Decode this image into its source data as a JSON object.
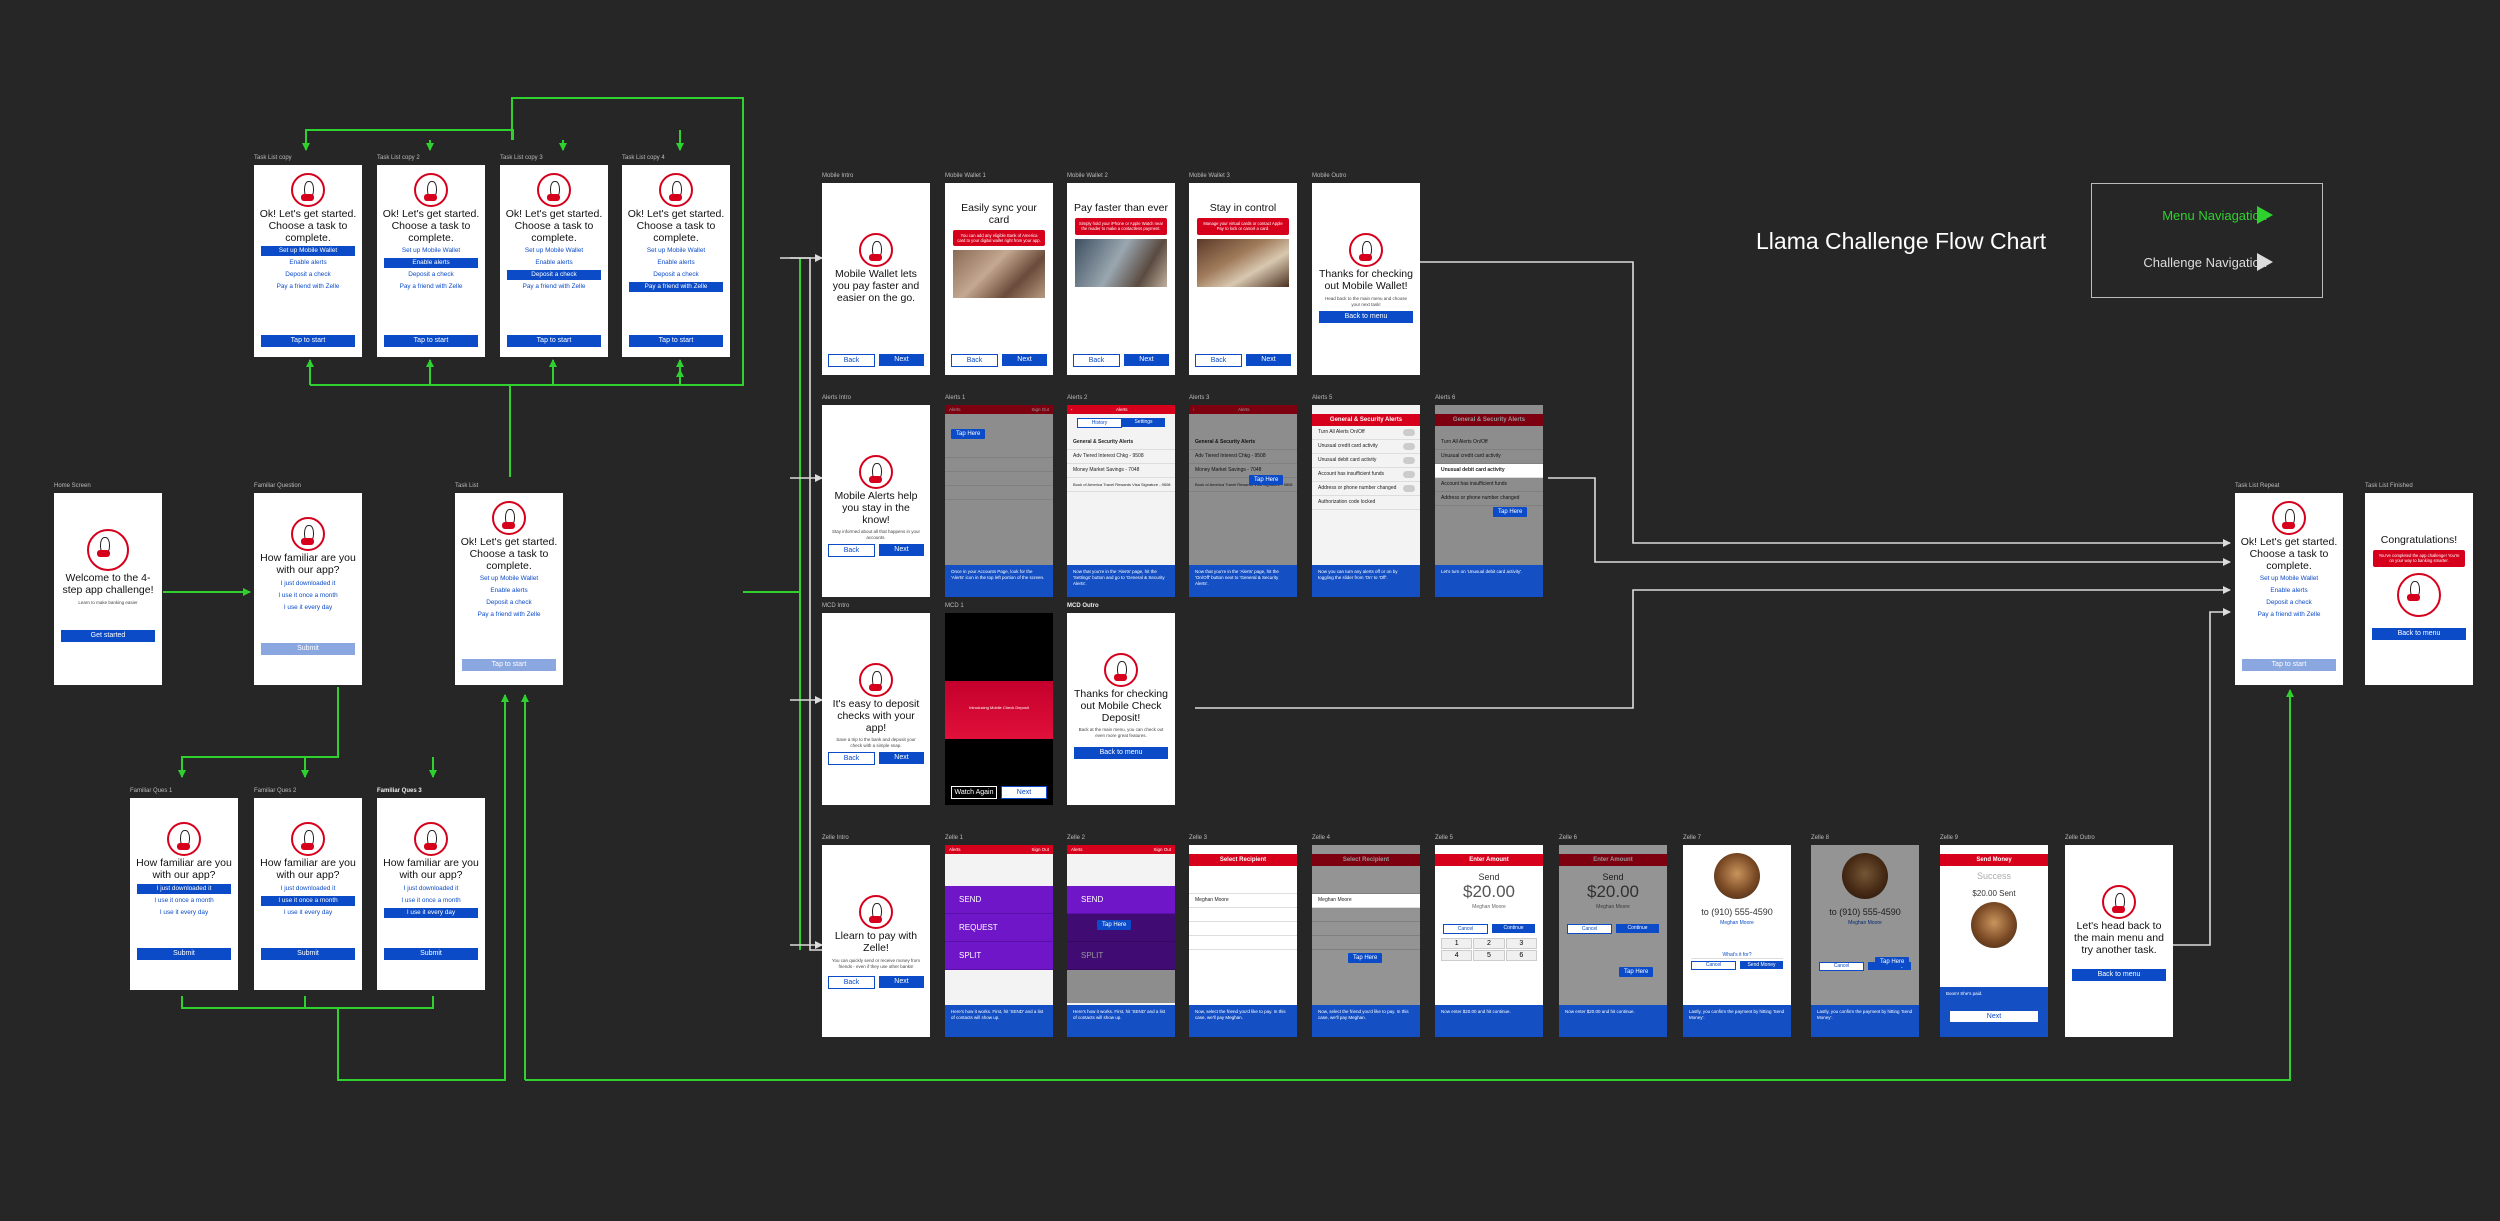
{
  "title": "Llama Challenge Flow Chart",
  "legend": {
    "menu": "Menu Naviagation",
    "challenge": "Challenge Navigation",
    "menu_color": "#2ed12e",
    "challenge_color": "#dcdcdc"
  },
  "labels": {
    "home": "Home Screen",
    "familiar_q": "Familiar Question",
    "task_list": "Task List",
    "tl_copy": "Task List copy",
    "tl_copy2": "Task List copy 2",
    "tl_copy3": "Task List copy 3",
    "tl_copy4": "Task List copy 4",
    "fq1": "Familiar Ques 1",
    "fq2": "Familiar Ques 2",
    "fq3": "Familiar Ques 3",
    "mw_intro": "Mobile Intro",
    "mw1": "Mobile Wallet 1",
    "mw2": "Mobile Wallet 2",
    "mw3": "Mobile Wallet 3",
    "mw_outro": "Mobile Outro",
    "al_intro": "Alerts Intro",
    "al1": "Alerts 1",
    "al2": "Alerts 2",
    "al3": "Alerts 3",
    "al5": "Alerts 5",
    "al6": "Alerts 6",
    "mcd_intro": "MCD Intro",
    "mcd1": "MCD 1",
    "mcd_outro": "MCD Outro",
    "z_intro": "Zelle Intro",
    "z1": "Zelle 1",
    "z2": "Zelle 2",
    "z3": "Zelle 3",
    "z4": "Zelle 4",
    "z5": "Zelle 5",
    "z6": "Zelle 6",
    "z7": "Zelle 7",
    "z8": "Zelle 8",
    "z9": "Zelle 9",
    "z_outro": "Zelle Outro",
    "tl_repeat": "Task List Repeat",
    "tl_finished": "Task List Finished"
  },
  "common": {
    "start_title": "Ok! Let's get started. Choose a task to complete.",
    "familiar_title": "How familiar are you with our app?",
    "tasks": [
      "Set up Mobile Wallet",
      "Enable alerts",
      "Deposit a check",
      "Pay a friend with Zelle"
    ],
    "familiar_opts": [
      "I just downloaded it",
      "I use it once a month",
      "I use it every day"
    ],
    "tap_to_start": "Tap to start",
    "submit": "Submit",
    "back": "Back",
    "next": "Next",
    "back_to_menu": "Back to menu",
    "tap_here": "Tap Here"
  },
  "home": {
    "title": "Welcome to the 4-step app challenge!",
    "sub": "Learn to make banking easier",
    "btn": "Get started"
  },
  "mw": {
    "intro": "Mobile Wallet lets you pay faster and easier on the go.",
    "s1": "Easily sync your card",
    "s2": "Pay faster than ever",
    "s3": "Stay in control",
    "b1": "You can add any eligible Bank of America card to your digital wallet right from your app.",
    "b2": "Simply hold your iPhone or Apple Watch near the reader to make a contactless payment.",
    "b3": "Manage your virtual cards or contact Apple Pay to lock or cancel a card.",
    "outro": "Thanks for checking out Mobile Wallet!",
    "outro_sub": "Head back to the main menu and choose your next task!"
  },
  "al": {
    "intro": "Mobile Alerts help you stay in the know!",
    "intro_sub": "Stay informed about all that happens in your accounts.",
    "app_title": "Alerts",
    "sign_out": "Sign Out",
    "tab1": "History",
    "tab2": "Settings",
    "gs": "General & Security Alerts",
    "rows": [
      "Adv Tiered Interest Chkg - 9508",
      "Money Market Savings - 7048",
      "Book of America Travel Rewards Visa Signature - 9508"
    ],
    "gs_rows": [
      "Turn All Alerts On/Off",
      "Unusual credit card activity",
      "Unusual debit card activity",
      "Account has insufficient funds",
      "Address or phone number changed",
      "Authorization code locked"
    ],
    "tip1": "Once in your Accounts Page, look for the 'Alerts' icon in the top left portion of the screen.",
    "tip2": "Now that you're in the 'Alerts' page, hit the 'Settings' button and go to 'General & Security Alerts'.",
    "tip3": "Now that you're in the 'Alerts' page, hit the 'On/Off' button next to 'General & Security Alerts'.",
    "tip5": "Now you can turn any alerts off or on by toggling the slider from 'On' to 'Off'.",
    "tip6": "Let's turn on 'Unusual debit card activity'."
  },
  "mcd": {
    "intro": "It's easy to deposit checks with your app!",
    "intro_sub": "Save a trip to the bank and deposit your check with a simple snap.",
    "video_text": "Introducing Mobile Check Deposit",
    "watch_again": "Watch Again",
    "outro": "Thanks for checking out Mobile Check Deposit!",
    "outro_sub": "Back at the main menu, you can check out even more great features."
  },
  "z": {
    "intro": "Llearn to pay with Zelle!",
    "intro_sub": "You can quickly send or receive money from friends - even if they use other banks!",
    "send": "SEND",
    "request": "REQUEST",
    "split": "SPLIT",
    "select_recipient": "Select Recipient",
    "enter_amount": "Enter Amount",
    "send_money": "Send Money",
    "amount_label": "Send",
    "amount": "$20.00",
    "recipient": "Meghan Moore",
    "phone": "to (910) 555-4590",
    "whats_for": "What's it for?",
    "cancel": "Cancel",
    "continue": "Continue",
    "send_btn": "Send Money",
    "success": "Success",
    "sent": "$20.00 Sent",
    "next": "Next",
    "tip1": "Here's how it works. First, hit 'SEND' and a list of contacts will show up.",
    "tip3": "Now, select the friend you'd like to pay. In this case, we'll pay Meghan.",
    "tip5": "Now enter $20.00 and hit continue.",
    "tip7": "Lastly, you confirm the payment by hitting 'Send Money'.",
    "tip9": "Boom! She's paid.",
    "outro": "Let's head back to the main menu and try another task."
  },
  "finished": {
    "title": "Congratulations!",
    "sub": "You've completed the app challenge! You're on your way to banking smarter."
  }
}
